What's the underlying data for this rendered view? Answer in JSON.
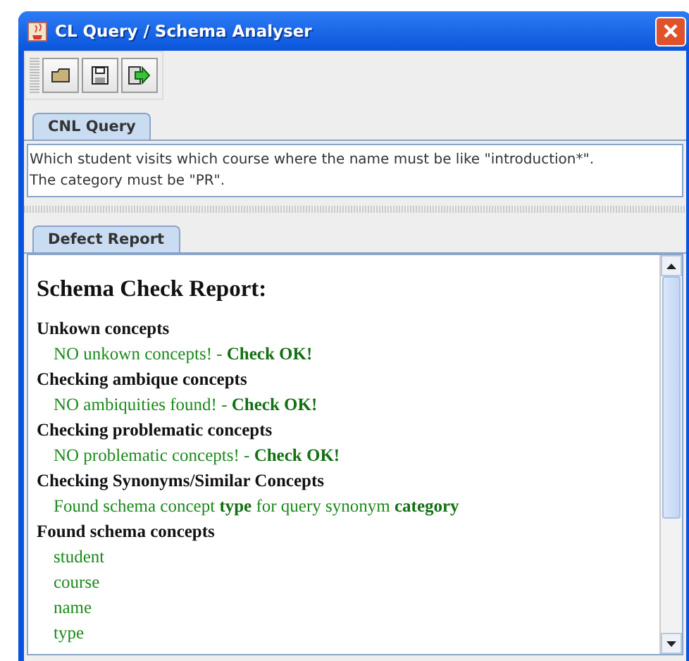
{
  "window": {
    "title": "CL Query / Schema Analyser"
  },
  "toolbar": {
    "buttons": [
      {
        "kind": "open"
      },
      {
        "kind": "save"
      },
      {
        "kind": "export"
      }
    ]
  },
  "query_tab": {
    "label": "CNL Query",
    "selected": true
  },
  "query_text": [
    "Which student visits which course where the name must be like \"introduction*\".",
    "The category must be \"PR\"."
  ],
  "report_tab": {
    "label": "Defect Report",
    "selected": true
  },
  "report": {
    "title": "Schema Check Report:",
    "sections": [
      {
        "heading": "Unkown concepts",
        "items": [
          "NO unkown concepts! - **Check OK!**"
        ]
      },
      {
        "heading": "Checking ambique concepts",
        "items": [
          "NO ambiquities found! - **Check OK!**"
        ]
      },
      {
        "heading": "Checking problematic concepts",
        "items": [
          "NO problematic concepts! - **Check OK!**"
        ]
      },
      {
        "heading": "Checking Synonyms/Similar Concepts",
        "items": [
          "Found schema concept **type** for query synonym **category**"
        ]
      },
      {
        "heading": "Found schema concepts",
        "items": [
          "student",
          "course",
          "name",
          "type"
        ]
      }
    ]
  }
}
